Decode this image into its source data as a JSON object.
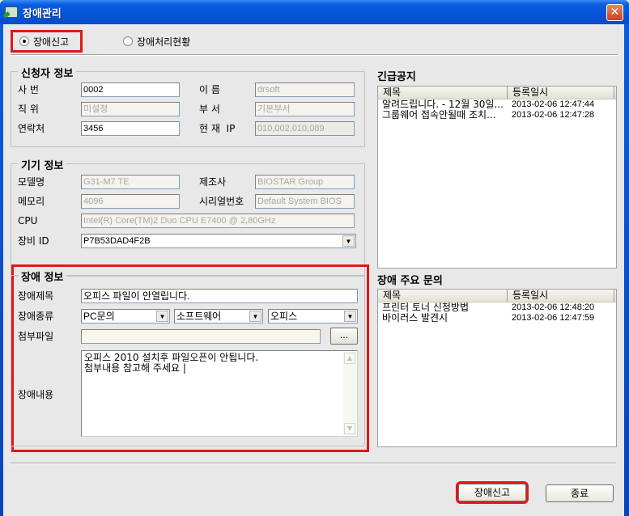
{
  "window": {
    "title": "장애관리",
    "icon": "app-icon",
    "close_label": "✕"
  },
  "mode": {
    "options": [
      {
        "label": "장애신고",
        "checked": true
      },
      {
        "label": "장애처리현황",
        "checked": false
      }
    ]
  },
  "requester": {
    "title": "신청자 정보",
    "employee_no_label": "사 번",
    "employee_no": "0002",
    "name_label": "이 름",
    "name": "drsoft",
    "position_label": "직 위",
    "position": "미설정",
    "dept_label": "부 서",
    "dept": "기본부서",
    "contact_label": "연락처",
    "contact": "3456",
    "ip_label": "현 재  IP",
    "ip": "010,002,010,089"
  },
  "device": {
    "title": "기기 정보",
    "model_label": "모델명",
    "model": "G31-M7 TE",
    "maker_label": "제조사",
    "maker": "BIOSTAR Group",
    "memory_label": "메모리",
    "memory": "4096",
    "serial_label": "시리얼번호",
    "serial": "Default System BIOS",
    "cpu_label": "CPU",
    "cpu": "Intel(R) Core(TM)2 Duo CPU E7400 @ 2,80GHz",
    "device_id_label": "장비 ID",
    "device_id": "P7B53DAD4F2B"
  },
  "issue": {
    "title": "장애 정보",
    "subject_label": "장애제목",
    "subject": "오피스 파일이 안열립니다.",
    "type_label": "장애종류",
    "type1": "PC문의",
    "type2": "소프트웨어",
    "type3": "오피스",
    "attach_label": "첨부파일",
    "attach": "",
    "browse_label": "...",
    "content_label": "장애내용",
    "content_lines": [
      "오피스 2010 설치후 파일오픈이 안됩니다.",
      "첨부내용 참고해 주세요 |"
    ]
  },
  "notices": {
    "title": "긴급공지",
    "columns": [
      "제목",
      "등록일시"
    ],
    "rows": [
      {
        "title": "알려드립니다. - 12월 30일...",
        "date": "2013-02-06 12:47:44"
      },
      {
        "title": "그룹웨어 접속안될때 조치...",
        "date": "2013-02-06 12:47:28"
      }
    ]
  },
  "faq": {
    "title": "장애 주요 문의",
    "columns": [
      "제목",
      "등록일시"
    ],
    "rows": [
      {
        "title": "프린터 토너 신청방법",
        "date": "2013-02-06 12:48:20"
      },
      {
        "title": "바이러스 발견시",
        "date": "2013-02-06 12:47:59"
      }
    ]
  },
  "footer": {
    "submit_label": "장애신고",
    "close_label": "종료"
  },
  "colors": {
    "highlight": "#e01818",
    "titlebar": "#0554d8",
    "client_bg": "#e8e8e8"
  }
}
